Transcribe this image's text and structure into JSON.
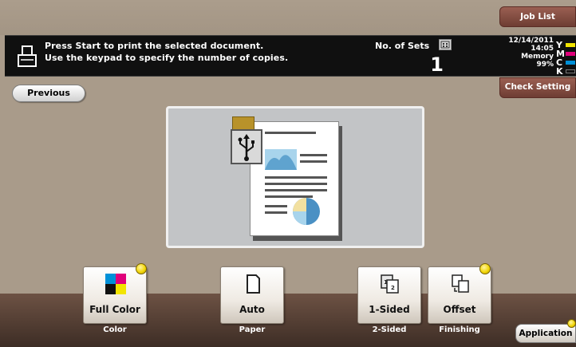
{
  "header": {
    "job_list_label": "Job List",
    "check_setting_label": "Check Setting"
  },
  "status": {
    "message_line1": "Press Start to print the selected document.",
    "message_line2": "Use the keypad to specify the number of copies.",
    "sets_label": "No. of Sets",
    "sets_value": "1",
    "date": "12/14/2011",
    "time": "14:05",
    "memory_label": "Memory",
    "memory_value": "99%",
    "toner": [
      {
        "letter": "Y",
        "color": "#f2e400"
      },
      {
        "letter": "M",
        "color": "#e0007a"
      },
      {
        "letter": "C",
        "color": "#0090d8"
      },
      {
        "letter": "K",
        "color": "#111111"
      }
    ]
  },
  "nav": {
    "previous_label": "Previous"
  },
  "functions": [
    {
      "label": "Full Color",
      "caption": "Color",
      "icon": "color-squares-icon"
    },
    {
      "label": "Auto",
      "caption": "Paper",
      "icon": "paper-sheet-icon"
    },
    {
      "label": "1-Sided",
      "caption": "2-Sided",
      "icon": "duplex-pages-icon"
    },
    {
      "label": "Offset",
      "caption": "Finishing",
      "icon": "offset-stack-icon"
    }
  ],
  "application_label": "Application",
  "colors": {
    "tab_brown": "#8a5246",
    "status_bg": "#101010",
    "indicator_yellow": "#f1d400"
  }
}
